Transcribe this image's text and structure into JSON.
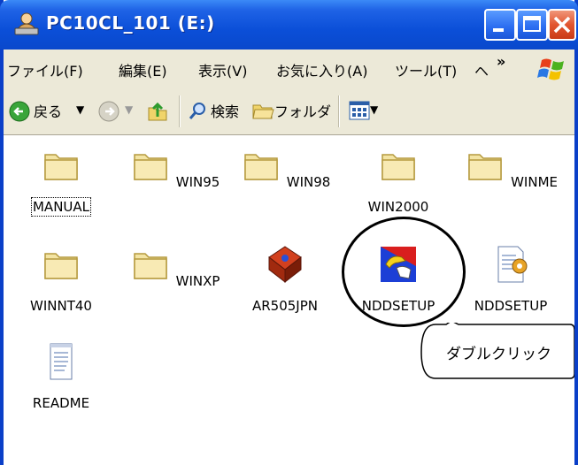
{
  "window": {
    "title": "PC10CL_101 (E:)"
  },
  "menu": {
    "items": [
      "ファイル(F)",
      "編集(E)",
      "表示(V)",
      "お気に入り(A)",
      "ツール(T)",
      "ヘ"
    ],
    "more": "»"
  },
  "toolbar": {
    "back_label": "戻る",
    "search_label": "検索",
    "folders_label": "フォルダ"
  },
  "files": [
    {
      "name": "MANUAL",
      "type": "folder"
    },
    {
      "name": "WIN95",
      "type": "folder"
    },
    {
      "name": "WIN98",
      "type": "folder"
    },
    {
      "name": "WIN2000",
      "type": "folder"
    },
    {
      "name": "WINME",
      "type": "folder"
    },
    {
      "name": "WINNT40",
      "type": "folder"
    },
    {
      "name": "WINXP",
      "type": "folder"
    },
    {
      "name": "AR505JPN",
      "type": "app"
    },
    {
      "name": "NDDSETUP",
      "type": "setup-exe"
    },
    {
      "name": "NDDSETUP",
      "type": "setup-config"
    },
    {
      "name": "README",
      "type": "text"
    }
  ],
  "callout": {
    "text": "ダブルクリック"
  },
  "colors": {
    "titlebar": "#0a48cc",
    "chrome": "#ece9d8",
    "folder": "#f3e4a3",
    "close": "#e2552f"
  }
}
